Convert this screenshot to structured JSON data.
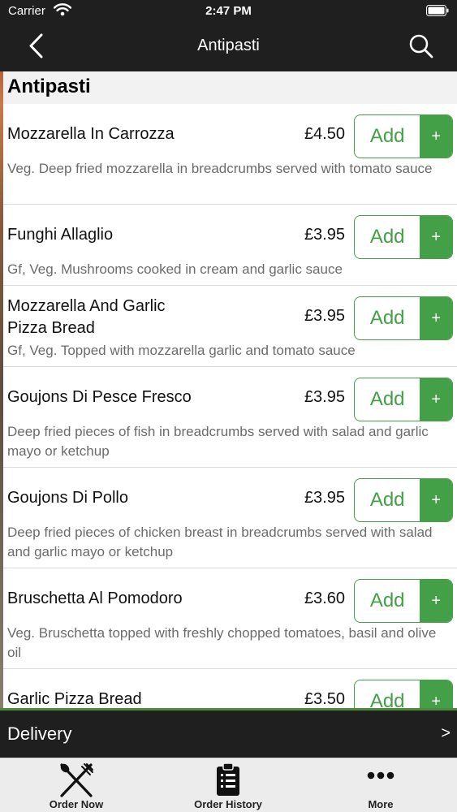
{
  "status_bar": {
    "carrier": "Carrier",
    "time": "2:47 PM"
  },
  "nav": {
    "title": "Antipasti",
    "back_icon": "chevron-left-icon",
    "search_icon": "search-icon"
  },
  "section": {
    "title": "Antipasti"
  },
  "add_label": "Add",
  "plus_label": "+",
  "items": [
    {
      "name": "Mozzarella In Carrozza",
      "price": "£4.50",
      "description": "Veg. Deep fried mozzarella in breadcrumbs served with tomato sauce"
    },
    {
      "name": "Funghi Allaglio",
      "price": "£3.95",
      "description": "Gf, Veg. Mushrooms cooked in cream and garlic sauce"
    },
    {
      "name": "Mozzarella And Garlic Pizza Bread",
      "price": "£3.95",
      "description": "Gf, Veg. Topped with mozzarella garlic and tomato sauce"
    },
    {
      "name": "Goujons Di Pesce Fresco",
      "price": "£3.95",
      "description": "Deep fried pieces of fish in breadcrumbs served with salad and garlic mayo or ketchup"
    },
    {
      "name": "Goujons Di Pollo",
      "price": "£3.95",
      "description": "Deep fried pieces of chicken breast in breadcrumbs served with salad and garlic mayo or ketchup"
    },
    {
      "name": "Bruschetta Al Pomodoro",
      "price": "£3.60",
      "description": "Veg. Bruschetta topped with freshly chopped tomatoes, basil and olive oil"
    },
    {
      "name": "Garlic Pizza Bread",
      "price": "£3.50",
      "description": ""
    }
  ],
  "delivery": {
    "label": "Delivery",
    "arrow": ">"
  },
  "tabs": [
    {
      "label": "Order Now",
      "icon": "fork-knife-icon"
    },
    {
      "label": "Order History",
      "icon": "clipboard-icon"
    },
    {
      "label": "More",
      "icon": "more-dots-icon"
    }
  ],
  "colors": {
    "accent": "#43a047",
    "bar": "#1f1f1f",
    "tabbar": "#ececec"
  }
}
